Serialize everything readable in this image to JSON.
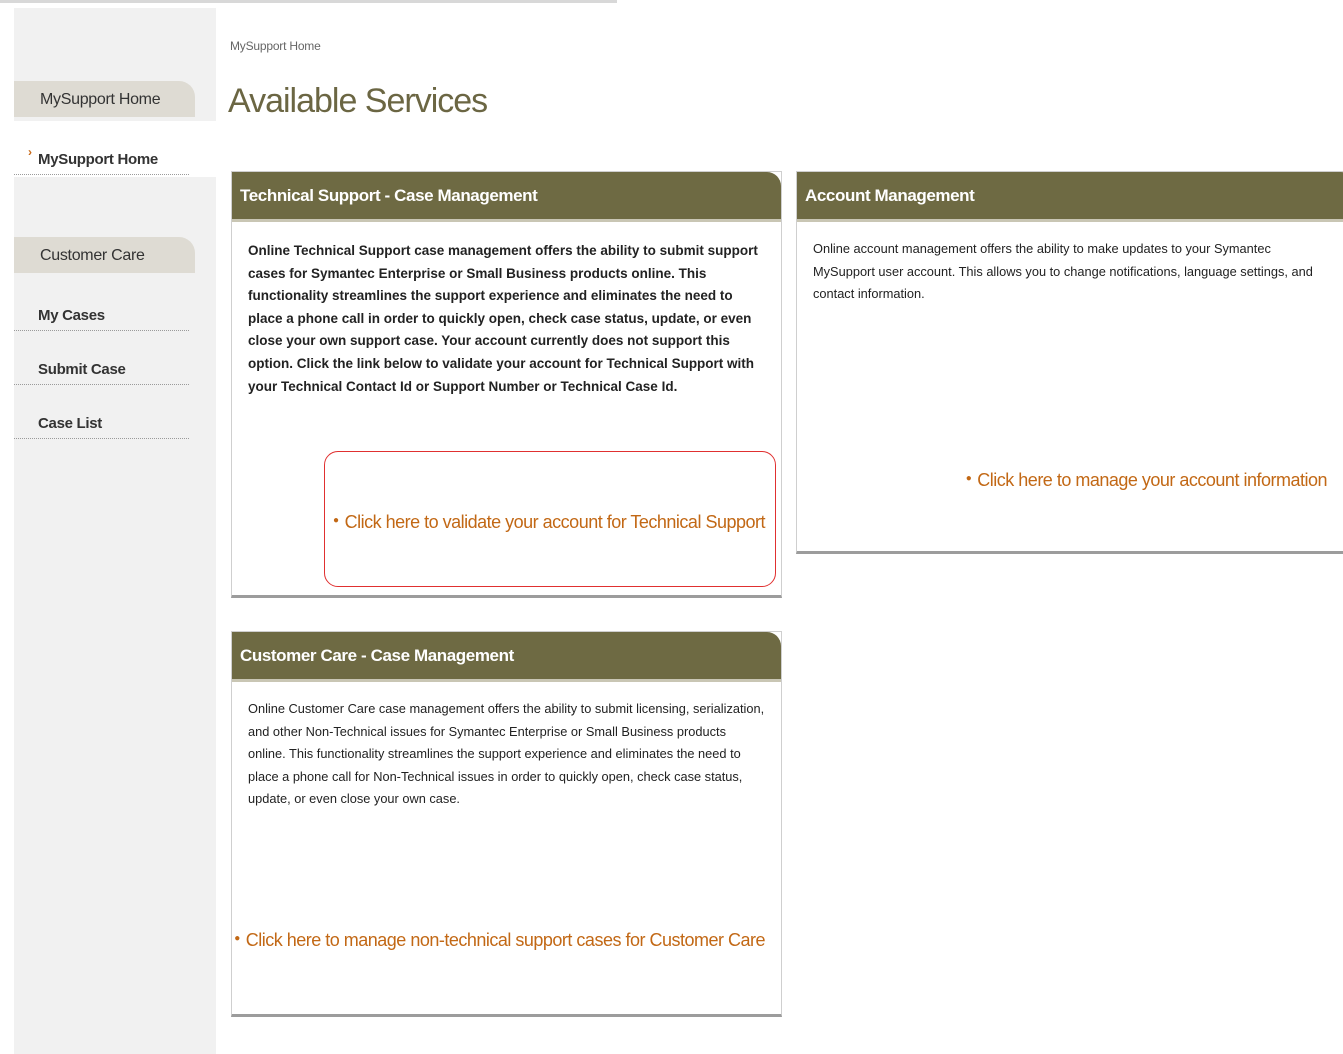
{
  "breadcrumb": "MySupport Home",
  "page_title": "Available Services",
  "sidebar": {
    "section1_title": "MySupport Home",
    "section1_items": [
      {
        "label": "MySupport Home",
        "current": true
      }
    ],
    "section2_title": "Customer Care",
    "section2_items": [
      {
        "label": "My Cases"
      },
      {
        "label": "Submit Case"
      },
      {
        "label": "Case List"
      }
    ]
  },
  "panels": {
    "technical": {
      "title": "Technical Support - Case Management",
      "body": "Online Technical Support case management offers the ability to submit support cases for Symantec Enterprise or Small Business products online. This functionality streamlines the support experience and eliminates the need to place a phone call in order to quickly open, check case status, update, or even close your own support case. Your account currently does not support this option. Click the link below to validate your account for Technical Support with your Technical Contact Id or Support Number or Technical Case Id.",
      "link": "Click here to validate your account for Technical Support"
    },
    "account": {
      "title": "Account Management",
      "body": "Online account management offers the ability to make updates to your Symantec MySupport user account. This allows you to change notifications, language settings, and contact information.",
      "link": "Click here to manage your account information"
    },
    "customer_care": {
      "title": "Customer Care - Case Management",
      "body": "Online Customer Care case management offers the ability to submit licensing, serialization, and other Non-Technical issues for Symantec Enterprise or Small Business products online. This functionality streamlines the support experience and eliminates the need to place a phone call for Non-Technical issues in order to quickly open, check case status, update, or even close your own case.",
      "link": "Click here to manage non-technical support cases for Customer Care"
    }
  },
  "colors": {
    "panel_header": "#6e6a43",
    "title": "#6b6643",
    "link": "#c26815",
    "highlight": "#e03030"
  }
}
